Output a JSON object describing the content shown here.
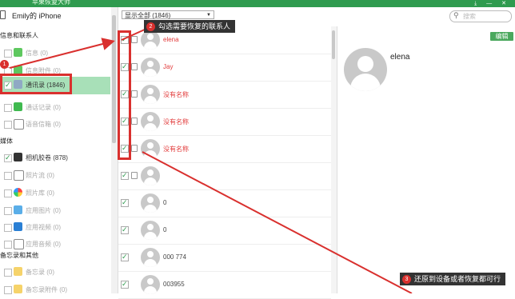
{
  "window": {
    "title": "苹果恢复大师"
  },
  "sidebar": {
    "device": "Emily的 iPhone",
    "sections": [
      {
        "title": "信息和联系人"
      },
      {
        "title": "媒体"
      },
      {
        "title": "备忘录和其他"
      }
    ],
    "items": [
      {
        "label": "信息 (0)"
      },
      {
        "label": "信息附件 (0)"
      },
      {
        "label": "通讯录 (1846)"
      },
      {
        "label": "通话记录 (0)"
      },
      {
        "label": "语音信箱 (0)"
      },
      {
        "label": "相机胶卷 (878)"
      },
      {
        "label": "照片流 (0)"
      },
      {
        "label": "照片库 (0)"
      },
      {
        "label": "应用图片 (0)"
      },
      {
        "label": "应用视频 (0)"
      },
      {
        "label": "应用音频 (0)"
      },
      {
        "label": "备忘录 (0)"
      },
      {
        "label": "备忘录附件 (0)"
      }
    ]
  },
  "toolbar": {
    "filter": "显示全部 (1846)",
    "search_placeholder": "搜索"
  },
  "contacts": [
    {
      "name": "elena",
      "checked": true
    },
    {
      "name": "Jay",
      "checked": true
    },
    {
      "name": "没有名称",
      "checked": true
    },
    {
      "name": "没有名称",
      "checked": true
    },
    {
      "name": "没有名称",
      "checked": true
    },
    {
      "name": "",
      "checked": true
    },
    {
      "name": "0",
      "checked": true
    },
    {
      "name": "0",
      "checked": true
    },
    {
      "name": "000 774",
      "checked": true
    },
    {
      "name": "003955",
      "checked": true
    }
  ],
  "detail": {
    "edit_label": "编辑",
    "name": "elena"
  },
  "annotations": [
    {
      "number": "1",
      "text": ""
    },
    {
      "number": "2",
      "text": "勾选需要恢复的联系人"
    },
    {
      "number": "3",
      "text": "还原到设备或者恢复都可行"
    }
  ],
  "colors": {
    "accent": "#2f9b4f",
    "annotation_red": "#d9302e",
    "deleted_name": "#e23b3b"
  }
}
